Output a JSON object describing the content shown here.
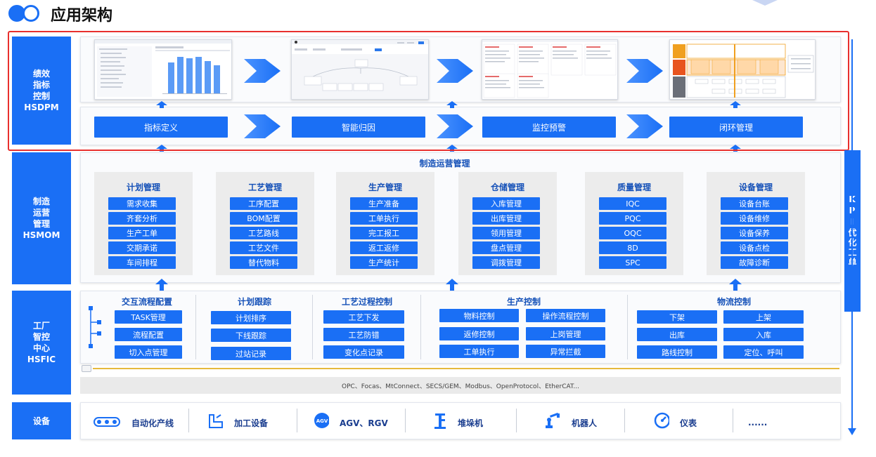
{
  "page_title": "应用架构",
  "layers": {
    "hsdpm": "绩效\n指标\n控制\nHSDPM",
    "hsmom": "制造\n运营\n管理\nHSMOM",
    "hsfic": "工厂\n智控\n中心\nHSFIC",
    "device": "设备"
  },
  "kpi_label": "KPI优化工单",
  "hsdpm_flow": [
    "指标定义",
    "智能归因",
    "监控预警",
    "闭环管理"
  ],
  "mom": {
    "title": "制造运营管理",
    "modules": [
      {
        "title": "计划管理",
        "items": [
          "需求收集",
          "齐套分析",
          "生产工单",
          "交期承诺",
          "车间排程"
        ]
      },
      {
        "title": "工艺管理",
        "items": [
          "工序配置",
          "BOM配置",
          "工艺路线",
          "工艺文件",
          "替代物料"
        ]
      },
      {
        "title": "生产管理",
        "items": [
          "生产准备",
          "工单执行",
          "完工报工",
          "返工返修",
          "生产统计"
        ]
      },
      {
        "title": "仓储管理",
        "items": [
          "入库管理",
          "出库管理",
          "领用管理",
          "盘点管理",
          "调拨管理"
        ]
      },
      {
        "title": "质量管理",
        "items": [
          "IQC",
          "PQC",
          "OQC",
          "8D",
          "SPC"
        ]
      },
      {
        "title": "设备管理",
        "items": [
          "设备台账",
          "设备维修",
          "设备保养",
          "设备点检",
          "故障诊断"
        ]
      }
    ]
  },
  "fic": {
    "groups": [
      {
        "title": "交互流程配置",
        "items": [
          "TASK管理",
          "流程配置",
          "切入点管理"
        ]
      },
      {
        "title": "计划跟踪",
        "items": [
          "计划排序",
          "下线跟踪",
          "过站记录"
        ]
      },
      {
        "title": "工艺过程控制",
        "items": [
          "工艺下发",
          "工艺防错",
          "变化点记录"
        ]
      },
      {
        "title": "生产控制",
        "items": [
          "物料控制",
          "操作流程控制",
          "返修控制",
          "上岗管理",
          "工单执行",
          "异常拦截"
        ]
      },
      {
        "title": "物流控制",
        "items": [
          "下架",
          "上架",
          "出库",
          "入库",
          "路线控制",
          "定位、呼叫"
        ]
      }
    ],
    "protocols": "OPC、Focas、MtConnect、SECS/GEM、Modbus、OpenProtocol、EtherCAT..."
  },
  "devices": [
    {
      "icon": "conveyor-icon",
      "label": "自动化产线"
    },
    {
      "icon": "machine-tool-icon",
      "label": "加工设备"
    },
    {
      "icon": "agv-icon",
      "label": "AGV、RGV"
    },
    {
      "icon": "stacker-icon",
      "label": "堆垛机"
    },
    {
      "icon": "robot-arm-icon",
      "label": "机器人"
    },
    {
      "icon": "gauge-icon",
      "label": "仪表"
    },
    {
      "icon": "",
      "label": "......"
    }
  ],
  "colors": {
    "primary": "#1a6ff5",
    "highlight": "#e8302e",
    "accent_orange": "#f0a020"
  },
  "thumb4": {
    "cells": [
      "质量管控",
      "一次合格率改善",
      "来料检验异常率",
      "产线异常频次"
    ],
    "side": [
      "闭环一致性跟踪报表",
      "专项改善项目计划表",
      "整改一致性结果记录"
    ]
  }
}
